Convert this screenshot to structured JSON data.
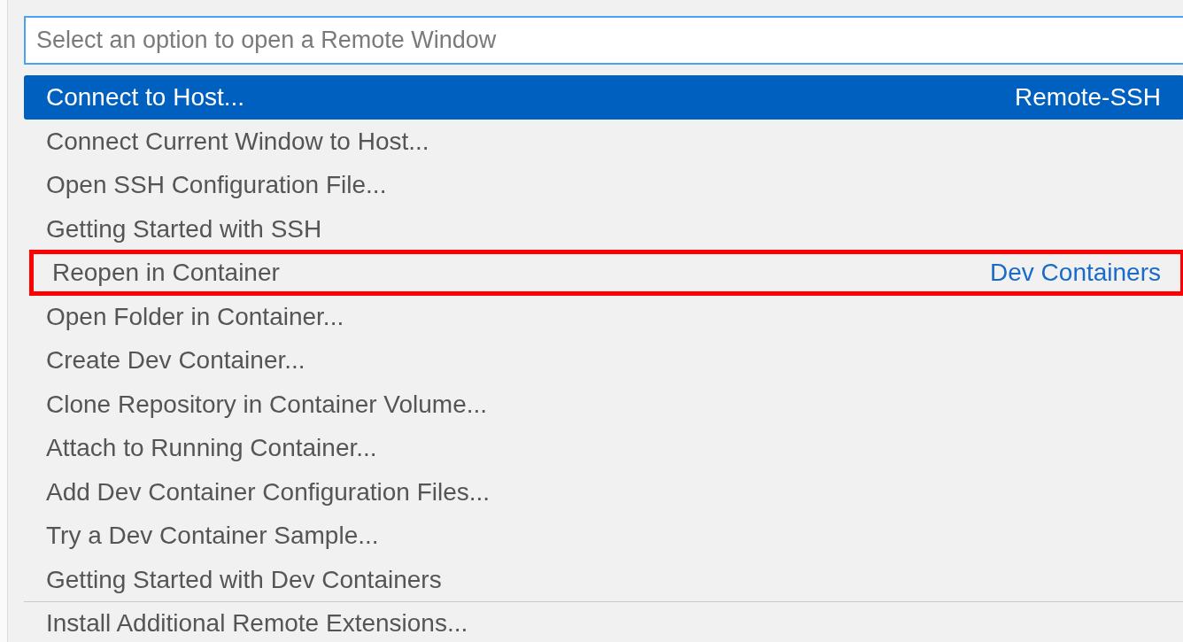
{
  "input": {
    "placeholder": "Select an option to open a Remote Window"
  },
  "items": [
    {
      "label": "Connect to Host...",
      "group": "Remote-SSH",
      "selected": true,
      "outlined": false,
      "separator_before": false
    },
    {
      "label": "Connect Current Window to Host...",
      "selected": false,
      "outlined": false,
      "separator_before": false
    },
    {
      "label": "Open SSH Configuration File...",
      "selected": false,
      "outlined": false,
      "separator_before": false
    },
    {
      "label": "Getting Started with SSH",
      "selected": false,
      "outlined": false,
      "separator_before": false
    },
    {
      "label": "Reopen in Container",
      "group": "Dev Containers",
      "selected": false,
      "outlined": true,
      "separator_before": false
    },
    {
      "label": "Open Folder in Container...",
      "selected": false,
      "outlined": false,
      "separator_before": false
    },
    {
      "label": "Create Dev Container...",
      "selected": false,
      "outlined": false,
      "separator_before": false
    },
    {
      "label": "Clone Repository in Container Volume...",
      "selected": false,
      "outlined": false,
      "separator_before": false
    },
    {
      "label": "Attach to Running Container...",
      "selected": false,
      "outlined": false,
      "separator_before": false
    },
    {
      "label": "Add Dev Container Configuration Files...",
      "selected": false,
      "outlined": false,
      "separator_before": false
    },
    {
      "label": "Try a Dev Container Sample...",
      "selected": false,
      "outlined": false,
      "separator_before": false
    },
    {
      "label": "Getting Started with Dev Containers",
      "selected": false,
      "outlined": false,
      "separator_before": false
    },
    {
      "label": "Install Additional Remote Extensions...",
      "selected": false,
      "outlined": false,
      "separator_before": true
    }
  ]
}
